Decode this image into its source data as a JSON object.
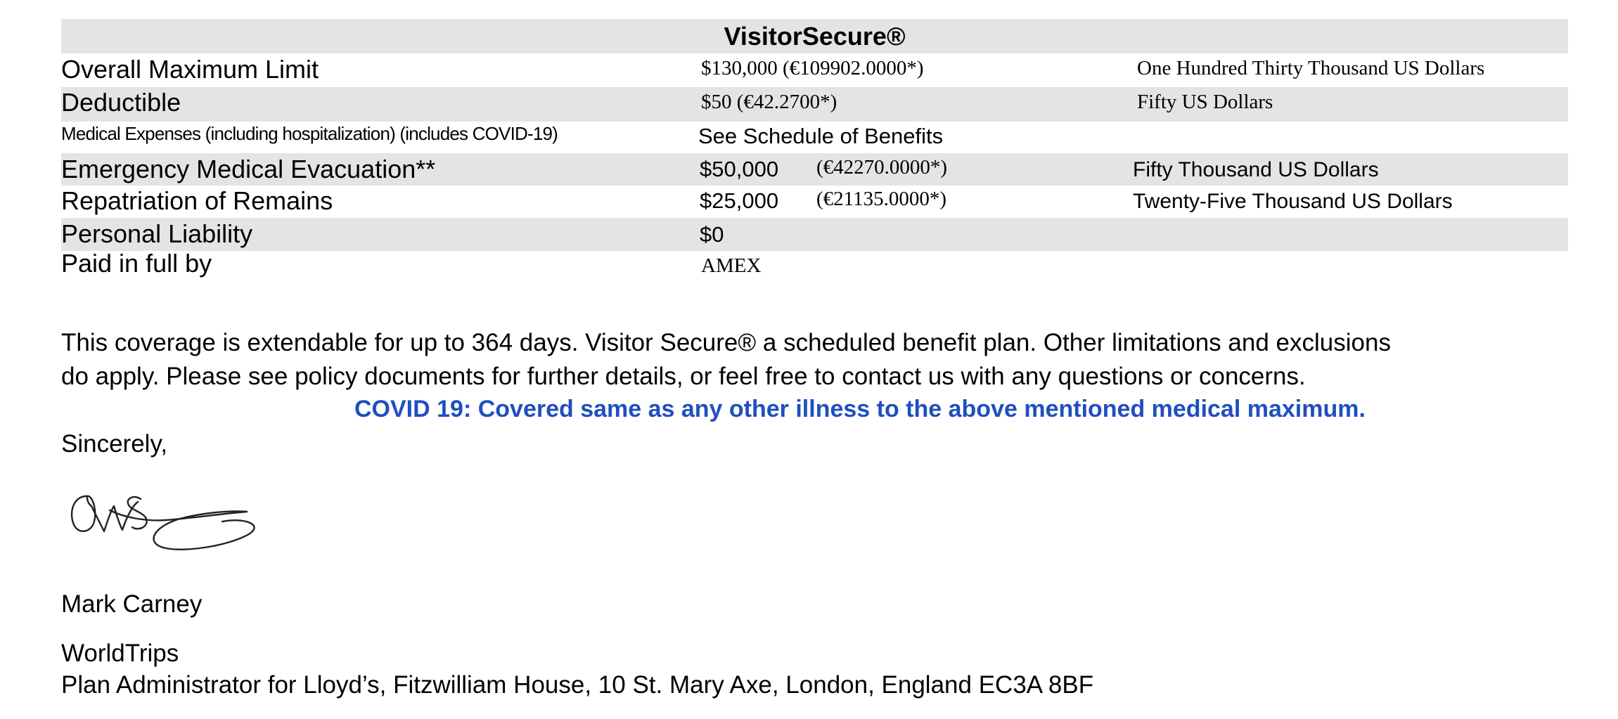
{
  "plan_table": {
    "title": "VisitorSecure®",
    "rows": [
      {
        "label": "Overall Maximum Limit",
        "amount": "$130,000 (€109902.0000*)",
        "words": "One Hundred Thirty Thousand US Dollars"
      },
      {
        "label": "Deductible",
        "amount": "$50 (€42.2700*)",
        "words": "Fifty US Dollars"
      },
      {
        "label": "Medical Expenses (including hospitalization) (includes COVID-19)",
        "amount": "See Schedule of Benefits",
        "words": ""
      },
      {
        "label": "Emergency Medical Evacuation**",
        "amount": "$50,000",
        "euro": "(€42270.0000*)",
        "words": "Fifty Thousand US Dollars"
      },
      {
        "label": "Repatriation of Remains",
        "amount": "$25,000",
        "euro": "(€21135.0000*)",
        "words": "Twenty-Five Thousand US Dollars"
      },
      {
        "label": "Personal Liability",
        "amount": "$0",
        "words": ""
      },
      {
        "label": "Paid in full by",
        "amount": "AMEX",
        "words": ""
      }
    ]
  },
  "coverage_note": {
    "line1": "This coverage is extendable for up to 364 days. Visitor Secure® a scheduled benefit plan. Other limitations and exclusions",
    "line2": "do apply. Please see policy documents for further details, or feel free to contact us with any questions or concerns."
  },
  "covid_note": "COVID 19: Covered same as any other illness to the above mentioned medical maximum.",
  "closing": "Sincerely,",
  "signer": {
    "name": "Mark Carney",
    "company": "WorldTrips",
    "title_address": "Plan Administrator for Lloyd’s, Fitzwilliam House, 10 St. Mary Axe, London, England EC3A 8BF"
  },
  "colors": {
    "row_shade": "#e4e4e4",
    "covid_text": "#1f4fbf",
    "text": "#000000"
  }
}
